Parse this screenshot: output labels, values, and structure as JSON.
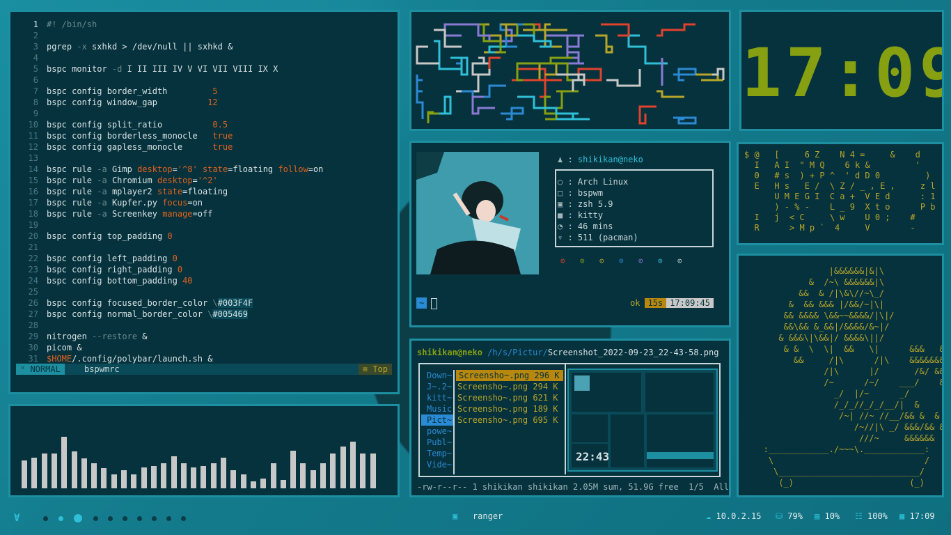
{
  "editor": {
    "lines": [
      {
        "n": "1",
        "parts": [
          [
            "dim",
            "#! /bin/sh"
          ]
        ]
      },
      {
        "n": "2",
        "parts": []
      },
      {
        "n": "3",
        "parts": [
          [
            "kw",
            "pgrep "
          ],
          [
            "dim",
            "-x "
          ],
          [
            "kw",
            "sxhkd > /dev/null || sxhkd &"
          ]
        ]
      },
      {
        "n": "4",
        "parts": []
      },
      {
        "n": "5",
        "parts": [
          [
            "kw",
            "bspc monitor "
          ],
          [
            "dim",
            "-d "
          ],
          [
            "kw",
            "I II III IV V VI VII VIII IX X"
          ]
        ]
      },
      {
        "n": "6",
        "parts": []
      },
      {
        "n": "7",
        "parts": [
          [
            "kw",
            "bspc config border_width         "
          ],
          [
            "val",
            "5"
          ]
        ]
      },
      {
        "n": "8",
        "parts": [
          [
            "kw",
            "bspc config window_gap          "
          ],
          [
            "val",
            "12"
          ]
        ]
      },
      {
        "n": "9",
        "parts": []
      },
      {
        "n": "10",
        "parts": [
          [
            "kw",
            "bspc config split_ratio          "
          ],
          [
            "val",
            "0.5"
          ]
        ]
      },
      {
        "n": "11",
        "parts": [
          [
            "kw",
            "bspc config borderless_monocle   "
          ],
          [
            "val",
            "true"
          ]
        ]
      },
      {
        "n": "12",
        "parts": [
          [
            "kw",
            "bspc config gapless_monocle      "
          ],
          [
            "val",
            "true"
          ]
        ]
      },
      {
        "n": "13",
        "parts": []
      },
      {
        "n": "14",
        "parts": [
          [
            "kw",
            "bspc rule "
          ],
          [
            "dim",
            "-a "
          ],
          [
            "kw",
            "Gimp "
          ],
          [
            "val",
            "desktop"
          ],
          [
            "kw",
            "="
          ],
          [
            "str",
            "'^8' "
          ],
          [
            "val",
            "state"
          ],
          [
            "kw",
            "=floating "
          ],
          [
            "val",
            "follow"
          ],
          [
            "kw",
            "=on"
          ]
        ]
      },
      {
        "n": "15",
        "parts": [
          [
            "kw",
            "bspc rule "
          ],
          [
            "dim",
            "-a "
          ],
          [
            "kw",
            "Chromium "
          ],
          [
            "val",
            "desktop"
          ],
          [
            "kw",
            "="
          ],
          [
            "str",
            "'^2'"
          ]
        ]
      },
      {
        "n": "16",
        "parts": [
          [
            "kw",
            "bspc rule "
          ],
          [
            "dim",
            "-a "
          ],
          [
            "kw",
            "mplayer2 "
          ],
          [
            "val",
            "state"
          ],
          [
            "kw",
            "=floating"
          ]
        ]
      },
      {
        "n": "17",
        "parts": [
          [
            "kw",
            "bspc rule "
          ],
          [
            "dim",
            "-a "
          ],
          [
            "kw",
            "Kupfer.py "
          ],
          [
            "val",
            "focus"
          ],
          [
            "kw",
            "=on"
          ]
        ]
      },
      {
        "n": "18",
        "parts": [
          [
            "kw",
            "bspc rule "
          ],
          [
            "dim",
            "-a "
          ],
          [
            "kw",
            "Screenkey "
          ],
          [
            "val",
            "manage"
          ],
          [
            "kw",
            "=off"
          ]
        ]
      },
      {
        "n": "19",
        "parts": []
      },
      {
        "n": "20",
        "parts": [
          [
            "kw",
            "bspc config top_padding "
          ],
          [
            "val",
            "0"
          ]
        ]
      },
      {
        "n": "21",
        "parts": []
      },
      {
        "n": "22",
        "parts": [
          [
            "kw",
            "bspc config left_padding "
          ],
          [
            "val",
            "0"
          ]
        ]
      },
      {
        "n": "23",
        "parts": [
          [
            "kw",
            "bspc config right_padding "
          ],
          [
            "val",
            "0"
          ]
        ]
      },
      {
        "n": "24",
        "parts": [
          [
            "kw",
            "bspc config bottom_padding "
          ],
          [
            "val",
            "40"
          ]
        ]
      },
      {
        "n": "25",
        "parts": []
      },
      {
        "n": "26",
        "parts": [
          [
            "kw",
            "bspc config focused_border_color "
          ],
          [
            "dim",
            "\\"
          ],
          [
            "hex",
            "#003F4F"
          ]
        ]
      },
      {
        "n": "27",
        "parts": [
          [
            "kw",
            "bspc config normal_border_color "
          ],
          [
            "dim",
            "\\"
          ],
          [
            "hex",
            "#005469"
          ]
        ]
      },
      {
        "n": "28",
        "parts": []
      },
      {
        "n": "29",
        "parts": [
          [
            "kw",
            "nitrogen "
          ],
          [
            "dim",
            "--restore "
          ],
          [
            "kw",
            "&"
          ]
        ]
      },
      {
        "n": "30",
        "parts": [
          [
            "kw",
            "picom &"
          ]
        ]
      },
      {
        "n": "31",
        "parts": [
          [
            "val",
            "$HOME"
          ],
          [
            "kw",
            "/.config/polybar/launch.sh &"
          ]
        ]
      }
    ],
    "mode": "ⱽ NORMAL",
    "filename": "bspwmrc",
    "position": "≡  Top"
  },
  "visualizer": {
    "bars": [
      0.33,
      0.37,
      0.42,
      0.42,
      0.62,
      0.44,
      0.36,
      0.3,
      0.24,
      0.17,
      0.22,
      0.17,
      0.25,
      0.27,
      0.3,
      0.38,
      0.3,
      0.25,
      0.27,
      0.3,
      0.37,
      0.22,
      0.17,
      0.08,
      0.12,
      0.3,
      0.1,
      0.45,
      0.3,
      0.22,
      0.3,
      0.42,
      0.5,
      0.56,
      0.42,
      0.42
    ]
  },
  "clock": {
    "time": "17:09"
  },
  "fetch": {
    "user": "shikikan@neko",
    "rows": [
      {
        "icon": "○",
        "text": "Arch Linux"
      },
      {
        "icon": "□",
        "text": "bspwm"
      },
      {
        "icon": "▣",
        "text": "zsh 5.9"
      },
      {
        "icon": "■",
        "text": "kitty"
      },
      {
        "icon": "◔",
        "text": "46 mins"
      },
      {
        "icon": "▿",
        "text": "511 (pacman)"
      }
    ],
    "dots": [
      "⊙",
      "⊙",
      "⊙",
      "⊙",
      "⊙",
      "⊙",
      "⊙"
    ],
    "dot_colors": [
      "#e0422c",
      "#86a012",
      "#b7a52a",
      "#2a8ad4",
      "#8a7ad4",
      "#2fc0d8",
      "#c8d6d8"
    ],
    "prompt": "~",
    "status_ok": "ok",
    "duration": "15s",
    "time": "17:09:45"
  },
  "ranger": {
    "user": "shikikan@neko",
    "path": " /h/s/Pictur/",
    "file": "Screenshot_2022-09-23_22-43-58.png",
    "dirs": [
      "Down~",
      "J~.2~",
      "kitt~",
      "Music",
      "Pict~",
      "powe~",
      "Publ~",
      "Temp~",
      "Vide~"
    ],
    "selected_dir": 4,
    "files": [
      {
        "name": "Screensho~.png",
        "size": "296 K"
      },
      {
        "name": "Screensho~.png",
        "size": "294 K"
      },
      {
        "name": "Screensho~.png",
        "size": "621 K"
      },
      {
        "name": "Screensho~.png",
        "size": "189 K"
      },
      {
        "name": "Screensho~.png",
        "size": "695 K"
      }
    ],
    "preview_clock": "22:43",
    "footer": "-rw-r--r-- 1 shikikan shikikan 2.05M sum, 51.9G free  1/5  All"
  },
  "noise": {
    "text": "$ @   [     6 Z    N 4 =     &    d\n  I   A I  \" M Q    6 k &         '\n  0   # s  ) + P ^  ' d D 0         )\n  E   H s   E /  \\ Z / _ , E ,     z l\n      U M E G I  C a +  V E d      : 1\n      ) - % -    L _ 9  X t o      P b\n  I   j  < C     \\ w    U 0 ;    #\n  R      > M p `  4     V        -"
  },
  "art": {
    "text": "                |&&&&&&|&|\\\n            &  /~\\ &&&&&&|\\\n          &&  & /|\\&\\//~\\_/\n        &  && &&& |/&&/~|\\|\n       && &&&& \\&&~~&&&&/|\\|/\n       &&\\&& &_&&|/&&&&/&~|/\n      & &&&\\|\\&&|/ &&&&\\||/\n       & &  \\  \\|  &&   \\|      &&&   & &\n         &&     /|\\      /|\\    &&&&&&&&&\n               /|\\      |/       /&/ &&\n               /~      /~/    ___/    &&\n                 _/  |/~      _/\n                 /_/_//_/_/__/|  &\n                  /~| //~ //__/&& &  &\n                     /~//|\\ _/ &&&/&& && &\n                      ///~     &&&&&&\n   :____________./~~~\\.____________:\n    \\                              /\n     \\____________________________/\n      (_)                       (_)"
  },
  "polybar": {
    "logo": "Ɐ",
    "window_icon": "▣",
    "window_title": "ranger",
    "net_icon": "☁",
    "net": "10.0.2.15",
    "disk_icon": "⛁",
    "disk": "79%",
    "mem_icon": "▤",
    "mem": "10%",
    "cpu_icon": "☷",
    "cpu": "100%",
    "date_icon": "▦",
    "time": "17:09"
  }
}
